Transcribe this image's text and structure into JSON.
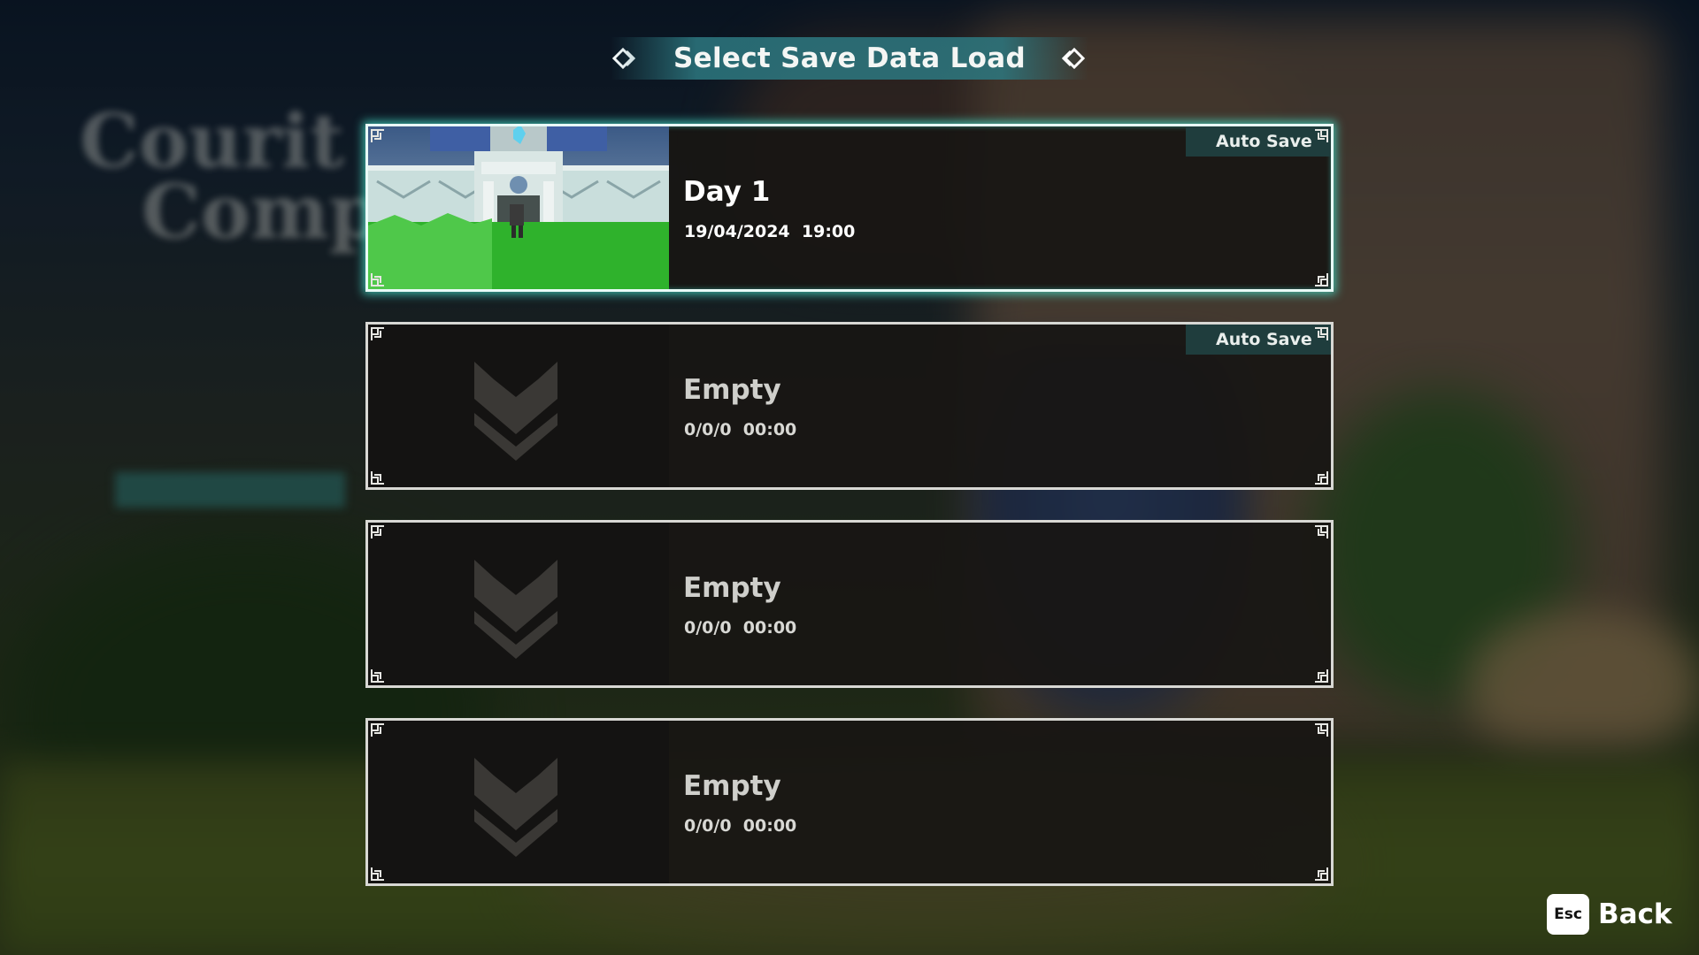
{
  "title": "Select Save Data Load",
  "background_menu": {
    "logo_lines": [
      "Courit",
      "Compa"
    ],
    "item_count": 6,
    "active_index": 2
  },
  "slots": [
    {
      "title": "Day 1",
      "date": "19/04/2024",
      "time": "19:00",
      "auto_save_label": "Auto Save",
      "has_preview": true,
      "selected": true
    },
    {
      "title": "Empty",
      "date": "0/0/0",
      "time": "00:00",
      "auto_save_label": "Auto Save",
      "has_preview": false,
      "selected": false
    },
    {
      "title": "Empty",
      "date": "0/0/0",
      "time": "00:00",
      "auto_save_label": "",
      "has_preview": false,
      "selected": false
    },
    {
      "title": "Empty",
      "date": "0/0/0",
      "time": "00:00",
      "auto_save_label": "",
      "has_preview": false,
      "selected": false
    }
  ],
  "back": {
    "key": "Esc",
    "label": "Back"
  },
  "colors": {
    "accent": "#2d7880",
    "selected_glow": "#46dcc8",
    "badge_bg": "#1f3d3d"
  }
}
